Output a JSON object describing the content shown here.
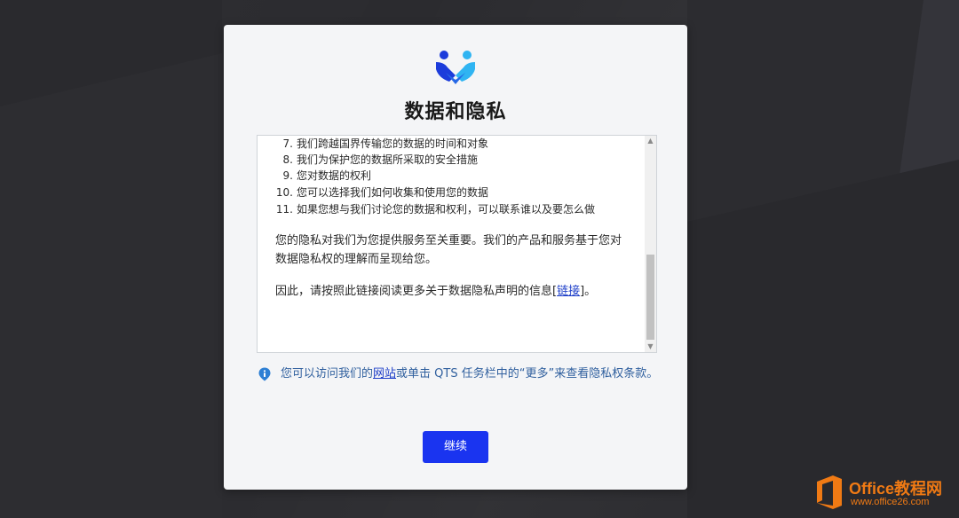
{
  "dialog": {
    "title": "数据和隐私",
    "list_items": [
      {
        "num": "7.",
        "text": "我们跨越国界传输您的数据的时间和对象"
      },
      {
        "num": "8.",
        "text": "我们为保护您的数据所采取的安全措施"
      },
      {
        "num": "9.",
        "text": "您对数据的权利"
      },
      {
        "num": "10.",
        "text": "您可以选择我们如何收集和使用您的数据"
      },
      {
        "num": "11.",
        "text": "如果您想与我们讨论您的数据和权利，可以联系谁以及要怎么做"
      }
    ],
    "para1": "您的隐私对我们为您提供服务至关重要。我们的产品和服务基于您对数据隐私权的理解而呈现给您。",
    "para2_prefix": "因此，请按照此链接阅读更多关于数据隐私声明的信息[",
    "para2_link": "链接",
    "para2_suffix": "]。",
    "info_prefix": "您可以访问我们的",
    "info_link": "网站",
    "info_suffix": "或单击 QTS 任务栏中的“更多”来查看隐私权条款。",
    "continue_label": "继续",
    "icons": {
      "logo": "handshake-people-icon",
      "info": "location-pin-info-icon",
      "scroll_up": "arrow-up-icon",
      "scroll_down": "arrow-down-icon"
    },
    "colors": {
      "accent": "#1a34f0",
      "logo_dark": "#1c3cdb",
      "logo_light": "#2fb4f2",
      "info_text": "#2f5f9e"
    }
  },
  "watermark": {
    "title": "Office教程网",
    "url": "www.office26.com",
    "icon": "office-logo-icon",
    "color": "#f07a14"
  }
}
